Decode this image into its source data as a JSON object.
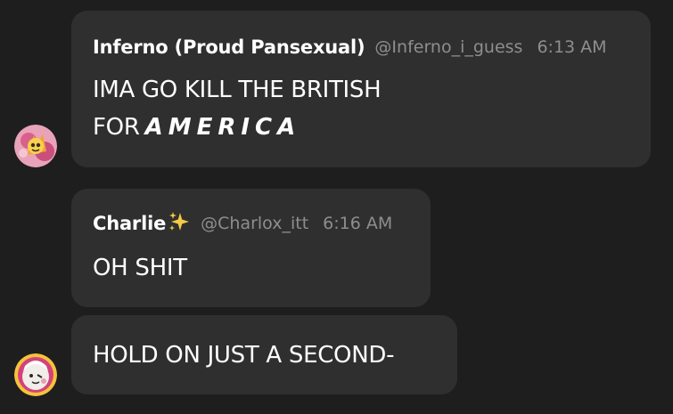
{
  "messages": [
    {
      "author": "Inferno (Proud Pansexual)",
      "handle": "@Inferno_i_guess",
      "time": "6:13 AM",
      "line1": "IMA GO KILL THE BRITISH",
      "line2_prefix": "FOR",
      "line2_emphasis": "AMERICA",
      "avatar_icon": "inferno-avatar"
    },
    {
      "author": "Charlie",
      "author_suffix_icon": "sparkles-icon",
      "handle": "@Charlox_itt",
      "time": "6:16 AM",
      "text": "OH SHIT",
      "avatar_icon": "charlie-avatar"
    },
    {
      "text": "HOLD ON JUST A SECOND-"
    }
  ],
  "colors": {
    "background": "#1e1e1e",
    "bubble": "#2f2f2f",
    "text": "#ffffff",
    "muted": "#8e8e8e",
    "sparkle": "#f7c948"
  }
}
